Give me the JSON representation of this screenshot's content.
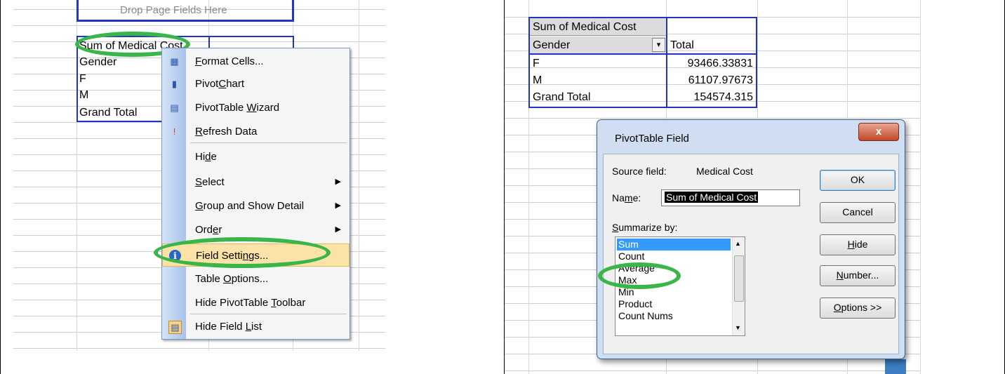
{
  "left": {
    "drop_hint": "Drop Page Fields Here",
    "pivot": {
      "header": "Sum of Medical Cost",
      "rows": [
        "Gender",
        "F",
        "M",
        "Grand Total"
      ]
    },
    "context_menu": {
      "items": [
        {
          "pre": "",
          "ul": "F",
          "post": "ormat Cells...",
          "icon": "format-cells-icon",
          "glyph": "▦",
          "submenu": false
        },
        {
          "pre": "Pivot",
          "ul": "C",
          "post": "hart",
          "icon": "pivotchart-icon",
          "glyph": "▮",
          "submenu": false
        },
        {
          "pre": "PivotTable ",
          "ul": "W",
          "post": "izard",
          "icon": "pivottable-wizard-icon",
          "glyph": "▤",
          "submenu": false
        },
        {
          "pre": "",
          "ul": "R",
          "post": "efresh Data",
          "icon": "refresh-data-icon",
          "glyph": "!",
          "submenu": false
        },
        {
          "pre": "Hi",
          "ul": "d",
          "post": "e",
          "icon": "",
          "glyph": "",
          "submenu": false
        },
        {
          "pre": "",
          "ul": "S",
          "post": "elect",
          "icon": "",
          "glyph": "",
          "submenu": true
        },
        {
          "pre": "",
          "ul": "G",
          "post": "roup and Show Detail",
          "icon": "",
          "glyph": "",
          "submenu": true
        },
        {
          "pre": "Ord",
          "ul": "e",
          "post": "r",
          "icon": "",
          "glyph": "",
          "submenu": true
        },
        {
          "pre": "Field Setti",
          "ul": "n",
          "post": "gs...",
          "icon": "field-settings-icon",
          "glyph": "ℹ",
          "submenu": false
        },
        {
          "pre": "Table ",
          "ul": "O",
          "post": "ptions...",
          "icon": "",
          "glyph": "",
          "submenu": false
        },
        {
          "pre": "Hide PivotTable ",
          "ul": "T",
          "post": "oolbar",
          "icon": "",
          "glyph": "",
          "submenu": false
        },
        {
          "pre": "Hide Field ",
          "ul": "L",
          "post": "ist",
          "icon": "field-list-icon",
          "glyph": "▤",
          "submenu": false
        }
      ]
    }
  },
  "right": {
    "pivot": {
      "header": "Sum of Medical Cost",
      "col_row": "Gender",
      "total_label": "Total",
      "rows": [
        {
          "label": "F",
          "value": "93466.33831"
        },
        {
          "label": "M",
          "value": "61107.97673"
        },
        {
          "label": "Grand Total",
          "value": "154574.315"
        }
      ]
    },
    "dialog": {
      "title": "PivotTable Field",
      "close_glyph": "x",
      "source_label": "Source field:",
      "source_value": "Medical Cost",
      "name_label_pre": "Na",
      "name_label_ul": "m",
      "name_label_post": "e:",
      "name_value": "Sum of Medical Cost",
      "summarize_label_ul": "S",
      "summarize_label_post": "ummarize by:",
      "summarize_options": [
        "Sum",
        "Count",
        "Average",
        "Max",
        "Min",
        "Product",
        "Count Nums"
      ],
      "selected": "Sum",
      "buttons": {
        "ok": "OK",
        "cancel": "Cancel",
        "hide_ul": "H",
        "hide_post": "ide",
        "number_ul": "N",
        "number_post": "umber...",
        "options_ul": "O",
        "options_post": "ptions >>"
      }
    }
  }
}
